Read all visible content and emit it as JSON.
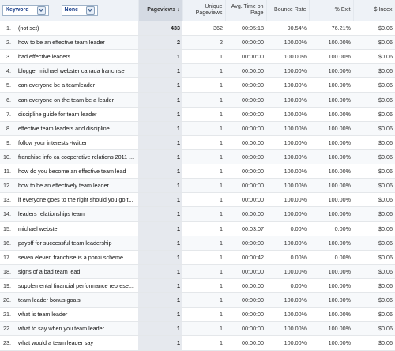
{
  "header": {
    "dimension_label": "Keyword",
    "secondary_label": "None",
    "pageviews": "Pageviews",
    "unique_pageviews": "Unique Pageviews",
    "avg_time": "Avg. Time on Page",
    "bounce_rate": "Bounce Rate",
    "exit_pct": "% Exit",
    "index": "$ Index"
  },
  "rows": [
    {
      "n": "1.",
      "kw": "(not set)",
      "pv": "433",
      "upv": "362",
      "time": "00:05:18",
      "bounce": "90.54%",
      "exit": "76.21%",
      "idx": "$0.06"
    },
    {
      "n": "2.",
      "kw": "how to be an effective team leader",
      "pv": "2",
      "upv": "2",
      "time": "00:00:00",
      "bounce": "100.00%",
      "exit": "100.00%",
      "idx": "$0.06"
    },
    {
      "n": "3.",
      "kw": "bad effective leaders",
      "pv": "1",
      "upv": "1",
      "time": "00:00:00",
      "bounce": "100.00%",
      "exit": "100.00%",
      "idx": "$0.06"
    },
    {
      "n": "4.",
      "kw": "blogger michael webster canada franchise",
      "pv": "1",
      "upv": "1",
      "time": "00:00:00",
      "bounce": "100.00%",
      "exit": "100.00%",
      "idx": "$0.06"
    },
    {
      "n": "5.",
      "kw": "can everyone be a teamleader",
      "pv": "1",
      "upv": "1",
      "time": "00:00:00",
      "bounce": "100.00%",
      "exit": "100.00%",
      "idx": "$0.06"
    },
    {
      "n": "6.",
      "kw": "can everyone on the team be a leader",
      "pv": "1",
      "upv": "1",
      "time": "00:00:00",
      "bounce": "100.00%",
      "exit": "100.00%",
      "idx": "$0.06"
    },
    {
      "n": "7.",
      "kw": "discipline guide for team leader",
      "pv": "1",
      "upv": "1",
      "time": "00:00:00",
      "bounce": "100.00%",
      "exit": "100.00%",
      "idx": "$0.06"
    },
    {
      "n": "8.",
      "kw": "effective team leaders and discipline",
      "pv": "1",
      "upv": "1",
      "time": "00:00:00",
      "bounce": "100.00%",
      "exit": "100.00%",
      "idx": "$0.06"
    },
    {
      "n": "9.",
      "kw": "follow your interests -twitter",
      "pv": "1",
      "upv": "1",
      "time": "00:00:00",
      "bounce": "100.00%",
      "exit": "100.00%",
      "idx": "$0.06"
    },
    {
      "n": "10.",
      "kw": "franchise info ca cooperative relations 2011 ...",
      "pv": "1",
      "upv": "1",
      "time": "00:00:00",
      "bounce": "100.00%",
      "exit": "100.00%",
      "idx": "$0.06"
    },
    {
      "n": "11.",
      "kw": "how do you become an effective team lead",
      "pv": "1",
      "upv": "1",
      "time": "00:00:00",
      "bounce": "100.00%",
      "exit": "100.00%",
      "idx": "$0.06"
    },
    {
      "n": "12.",
      "kw": "how to be an effectively team leader",
      "pv": "1",
      "upv": "1",
      "time": "00:00:00",
      "bounce": "100.00%",
      "exit": "100.00%",
      "idx": "$0.06"
    },
    {
      "n": "13.",
      "kw": "if everyone goes to the right should you go t...",
      "pv": "1",
      "upv": "1",
      "time": "00:00:00",
      "bounce": "100.00%",
      "exit": "100.00%",
      "idx": "$0.06"
    },
    {
      "n": "14.",
      "kw": "leaders relationships team",
      "pv": "1",
      "upv": "1",
      "time": "00:00:00",
      "bounce": "100.00%",
      "exit": "100.00%",
      "idx": "$0.06"
    },
    {
      "n": "15.",
      "kw": "michael webster",
      "pv": "1",
      "upv": "1",
      "time": "00:03:07",
      "bounce": "0.00%",
      "exit": "0.00%",
      "idx": "$0.06"
    },
    {
      "n": "16.",
      "kw": "payoff for successful team leadership",
      "pv": "1",
      "upv": "1",
      "time": "00:00:00",
      "bounce": "100.00%",
      "exit": "100.00%",
      "idx": "$0.06"
    },
    {
      "n": "17.",
      "kw": "seven eleven franchise is a ponzi scheme",
      "pv": "1",
      "upv": "1",
      "time": "00:00:42",
      "bounce": "0.00%",
      "exit": "0.00%",
      "idx": "$0.06"
    },
    {
      "n": "18.",
      "kw": "signs of a bad team lead",
      "pv": "1",
      "upv": "1",
      "time": "00:00:00",
      "bounce": "100.00%",
      "exit": "100.00%",
      "idx": "$0.06"
    },
    {
      "n": "19.",
      "kw": "supplemental financial performance represe...",
      "pv": "1",
      "upv": "1",
      "time": "00:00:00",
      "bounce": "0.00%",
      "exit": "100.00%",
      "idx": "$0.06"
    },
    {
      "n": "20.",
      "kw": "team leader bonus goals",
      "pv": "1",
      "upv": "1",
      "time": "00:00:00",
      "bounce": "100.00%",
      "exit": "100.00%",
      "idx": "$0.06"
    },
    {
      "n": "21.",
      "kw": "what is team leader",
      "pv": "1",
      "upv": "1",
      "time": "00:00:00",
      "bounce": "100.00%",
      "exit": "100.00%",
      "idx": "$0.06"
    },
    {
      "n": "22.",
      "kw": "what to say when you team leader",
      "pv": "1",
      "upv": "1",
      "time": "00:00:00",
      "bounce": "100.00%",
      "exit": "100.00%",
      "idx": "$0.06"
    },
    {
      "n": "23.",
      "kw": "what would a team leader say",
      "pv": "1",
      "upv": "1",
      "time": "00:00:00",
      "bounce": "100.00%",
      "exit": "100.00%",
      "idx": "$0.06"
    }
  ],
  "icons": {
    "dropdown": "chevron-down-icon",
    "sort": "sort-down-arrow"
  }
}
